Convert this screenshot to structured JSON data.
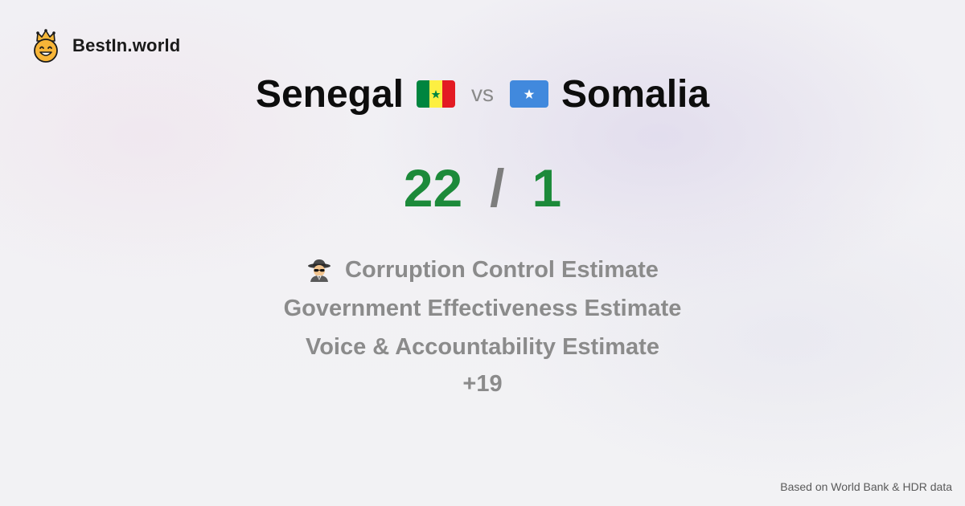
{
  "brand": {
    "name": "BestIn.world",
    "logo_icon": "crowned-smiley-icon"
  },
  "comparison": {
    "left_country": "Senegal",
    "left_flag": "senegal-flag-icon",
    "vs_label": "vs",
    "right_country": "Somalia",
    "right_flag": "somalia-flag-icon"
  },
  "score": {
    "left": "22",
    "separator": "/",
    "right": "1",
    "color": "#1c8a3a"
  },
  "metrics": {
    "icon": "spy-icon",
    "items": [
      "Corruption Control Estimate",
      "Government Effectiveness Estimate",
      "Voice & Accountability Estimate"
    ],
    "more": "+19"
  },
  "footer": {
    "source_note": "Based on World Bank & HDR data"
  },
  "colors": {
    "senegal_green": "#00853f",
    "senegal_yellow": "#fdef42",
    "senegal_red": "#e31b23",
    "somalia_blue": "#4189dd"
  }
}
